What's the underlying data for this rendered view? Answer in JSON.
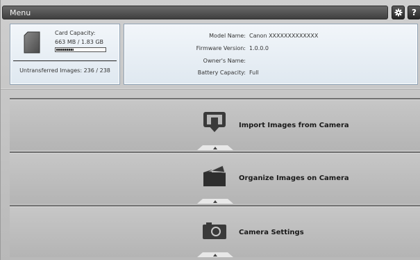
{
  "menubar": {
    "title": "Menu"
  },
  "toolbar": {
    "settings_icon": "gear-icon",
    "help_label": "?"
  },
  "card": {
    "icon": "sd-card-icon",
    "capacity_label": "Card Capacity:",
    "capacity_value": "663 MB / 1.83 GB",
    "capacity_fraction": 0.35,
    "untransferred": "Untransferred Images: 236 / 238"
  },
  "camera": {
    "model_label": "Model Name:",
    "model_value": "Canon  XXXXXXXXXXXXX",
    "firmware_label": "Firmware Version:",
    "firmware_value": "1.0.0.0",
    "owner_label": "Owner's Name:",
    "owner_value": "",
    "battery_label": "Battery Capacity:",
    "battery_value": "Full"
  },
  "sections": [
    {
      "label": "Import Images from Camera",
      "icon": "import-icon"
    },
    {
      "label": "Organize Images on Camera",
      "icon": "folder-icon"
    },
    {
      "label": "Camera Settings",
      "icon": "camera-icon"
    }
  ]
}
